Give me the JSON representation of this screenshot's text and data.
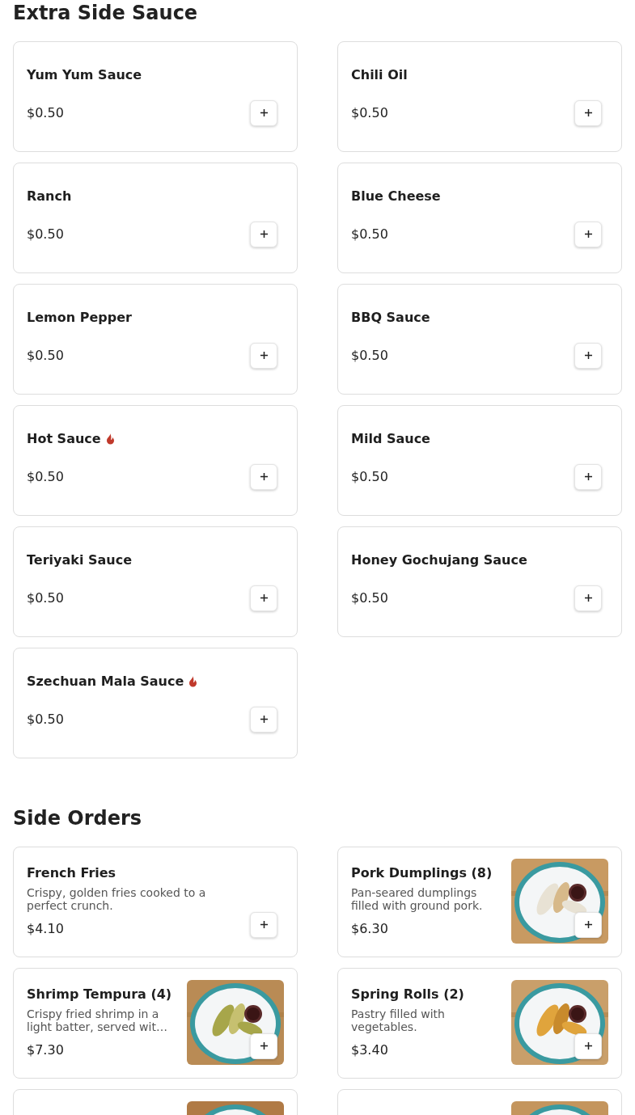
{
  "sections": [
    {
      "title": "Extra Side Sauce",
      "items": [
        {
          "name": "Yum Yum Sauce",
          "price": "$0.50",
          "spicy": false
        },
        {
          "name": "Chili Oil",
          "price": "$0.50",
          "spicy": false
        },
        {
          "name": "Ranch",
          "price": "$0.50",
          "spicy": false
        },
        {
          "name": "Blue Cheese",
          "price": "$0.50",
          "spicy": false
        },
        {
          "name": "Lemon Pepper",
          "price": "$0.50",
          "spicy": false
        },
        {
          "name": "BBQ Sauce",
          "price": "$0.50",
          "spicy": false
        },
        {
          "name": "Hot Sauce",
          "price": "$0.50",
          "spicy": true
        },
        {
          "name": "Mild Sauce",
          "price": "$0.50",
          "spicy": false
        },
        {
          "name": "Teriyaki Sauce",
          "price": "$0.50",
          "spicy": false
        },
        {
          "name": "Honey Gochujang Sauce",
          "price": "$0.50",
          "spicy": false
        },
        {
          "name": "Szechuan Mala Sauce",
          "price": "$0.50",
          "spicy": true
        }
      ]
    },
    {
      "title": "Side Orders",
      "items": [
        {
          "name": "French Fries",
          "description": "Crispy, golden fries cooked to a perfect crunch.",
          "price": "$4.10"
        },
        {
          "name": "Pork Dumplings (8)",
          "description": "Pan-seared dumplings filled with ground pork.",
          "price": "$6.30",
          "image": {
            "kind": "picture"
          }
        },
        {
          "name": "Shrimp Tempura (4)",
          "description": "Crispy fried shrimp in a light batter, served wit…",
          "price": "$7.30",
          "image": {
            "kind": "picture"
          }
        },
        {
          "name": "Spring Rolls (2)",
          "description": "Pastry filled with vegetables.",
          "price": "$3.40",
          "image": {
            "kind": "picture"
          }
        },
        {
          "image": {
            "kind": "picture"
          }
        },
        {
          "image": {
            "kind": "picture"
          }
        }
      ]
    }
  ]
}
